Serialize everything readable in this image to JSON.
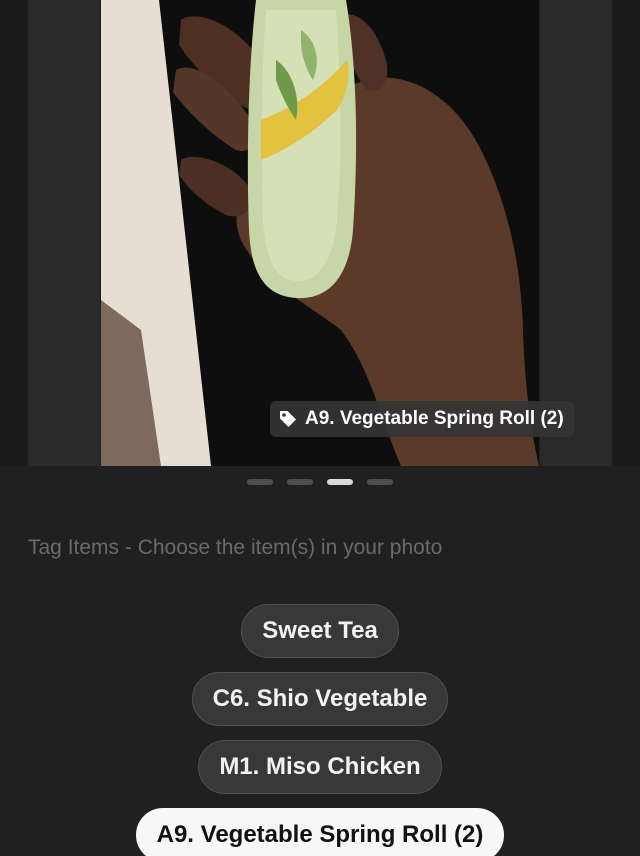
{
  "photo_tag": {
    "label": "A9. Vegetable Spring Roll (2)",
    "icon": "tag-icon"
  },
  "carousel": {
    "page_count": 4,
    "active_index": 2
  },
  "instruction": "Tag Items - Choose the item(s) in your photo",
  "items": [
    {
      "label": "Sweet Tea",
      "selected": false
    },
    {
      "label": "C6. Shio Vegetable",
      "selected": false
    },
    {
      "label": "M1. Miso Chicken",
      "selected": false
    },
    {
      "label": "A9. Vegetable Spring Roll (2)",
      "selected": true
    }
  ],
  "colors": {
    "background": "#202020",
    "chip": "#383838",
    "chip_selected": "#f7f7f7",
    "dot_active": "#d8d8d8",
    "dot_inactive": "#4e4e4e"
  }
}
